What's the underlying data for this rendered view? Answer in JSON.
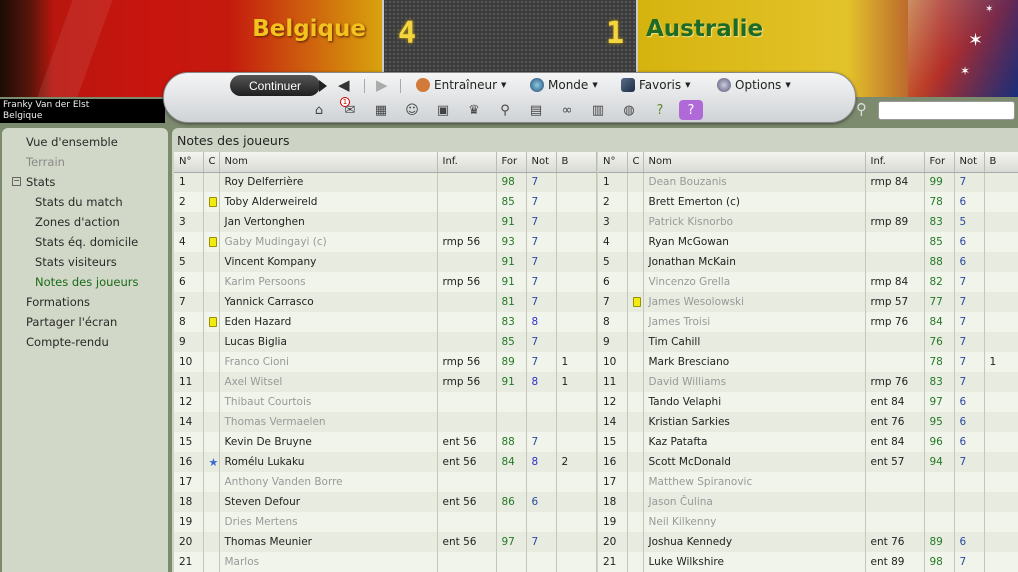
{
  "match": {
    "home_team": "Belgique",
    "away_team": "Australie",
    "home_score": "4",
    "away_score": "1"
  },
  "manager": {
    "name": "Franky Van der Elst",
    "team": "Belgique"
  },
  "toolbar": {
    "continue_label": "Continuer",
    "menus": [
      {
        "label": "Entraîneur",
        "icon": "coach-icon"
      },
      {
        "label": "Monde",
        "icon": "globe-icon"
      },
      {
        "label": "Favoris",
        "icon": "bookmark-icon"
      },
      {
        "label": "Options",
        "icon": "options-icon"
      }
    ],
    "icons": [
      "home-icon",
      "inbox-icon",
      "calendar-icon",
      "squad-icon",
      "tactics-icon",
      "trophy-icon",
      "scout-icon",
      "notes-icon",
      "binoculars-icon",
      "report-icon",
      "globe-world-icon",
      "help-icon",
      "question-icon"
    ],
    "inbox_count": "1"
  },
  "colors": {
    "home_text": "#f3c21e",
    "away_text": "#1d6b26",
    "form_green": "#257825",
    "rating_blue": "#2a48a0",
    "yellow_card": "#f2ea10"
  },
  "sidebar": {
    "items": [
      {
        "label": "Vue d'ensemble",
        "state": "normal",
        "level": 0
      },
      {
        "label": "Terrain",
        "state": "disabled",
        "level": 0
      },
      {
        "label": "Stats",
        "state": "expanded",
        "level": 0,
        "toggle": "−"
      },
      {
        "label": "Stats du match",
        "state": "normal",
        "level": 1
      },
      {
        "label": "Zones d'action",
        "state": "normal",
        "level": 1
      },
      {
        "label": "Stats éq. domicile",
        "state": "normal",
        "level": 1
      },
      {
        "label": "Stats visiteurs",
        "state": "normal",
        "level": 1
      },
      {
        "label": "Notes des joueurs",
        "state": "active",
        "level": 1
      },
      {
        "label": "Formations",
        "state": "normal",
        "level": 0
      },
      {
        "label": "Partager l'écran",
        "state": "normal",
        "level": 0
      },
      {
        "label": "Compte-rendu",
        "state": "normal",
        "level": 0
      }
    ]
  },
  "main": {
    "title": "Notes des joueurs",
    "columns": [
      "N°",
      "C",
      "Nom",
      "Inf.",
      "For",
      "Not",
      "B"
    ],
    "home_players": [
      {
        "no": "1",
        "card": "",
        "name": "Roy Delferrière",
        "sub": false,
        "info": "",
        "form": "98",
        "rating": "7",
        "goals": ""
      },
      {
        "no": "2",
        "card": "yellow",
        "name": "Toby Alderweireld",
        "sub": false,
        "info": "",
        "form": "85",
        "rating": "7",
        "goals": ""
      },
      {
        "no": "3",
        "card": "",
        "name": "Jan Vertonghen",
        "sub": false,
        "info": "",
        "form": "91",
        "rating": "7",
        "goals": ""
      },
      {
        "no": "4",
        "card": "yellow",
        "name": "Gaby Mudingayi (c)",
        "sub": true,
        "info": "rmp 56",
        "form": "93",
        "rating": "7",
        "goals": ""
      },
      {
        "no": "5",
        "card": "",
        "name": "Vincent Kompany",
        "sub": false,
        "info": "",
        "form": "91",
        "rating": "7",
        "goals": ""
      },
      {
        "no": "6",
        "card": "",
        "name": "Karim Persoons",
        "sub": true,
        "info": "rmp 56",
        "form": "91",
        "rating": "7",
        "goals": ""
      },
      {
        "no": "7",
        "card": "",
        "name": "Yannick Carrasco",
        "sub": false,
        "info": "",
        "form": "81",
        "rating": "7",
        "goals": ""
      },
      {
        "no": "8",
        "card": "yellow",
        "name": "Eden Hazard",
        "sub": false,
        "info": "",
        "form": "83",
        "rating": "8",
        "goals": ""
      },
      {
        "no": "9",
        "card": "",
        "name": "Lucas Biglia",
        "sub": false,
        "info": "",
        "form": "85",
        "rating": "7",
        "goals": ""
      },
      {
        "no": "10",
        "card": "",
        "name": "Franco Cioni",
        "sub": true,
        "info": "rmp 56",
        "form": "89",
        "rating": "7",
        "goals": "1"
      },
      {
        "no": "11",
        "card": "",
        "name": "Axel Witsel",
        "sub": true,
        "info": "rmp 56",
        "form": "91",
        "rating": "8",
        "goals": "1"
      },
      {
        "no": "12",
        "card": "",
        "name": "Thibaut Courtois",
        "sub": true,
        "info": "",
        "form": "",
        "rating": "",
        "goals": ""
      },
      {
        "no": "14",
        "card": "",
        "name": "Thomas Vermaelen",
        "sub": true,
        "info": "",
        "form": "",
        "rating": "",
        "goals": ""
      },
      {
        "no": "15",
        "card": "",
        "name": "Kevin De Bruyne",
        "sub": false,
        "info": "ent 56",
        "form": "88",
        "rating": "7",
        "goals": ""
      },
      {
        "no": "16",
        "card": "star",
        "name": "Romélu Lukaku",
        "sub": false,
        "info": "ent 56",
        "form": "84",
        "rating": "8",
        "goals": "2"
      },
      {
        "no": "17",
        "card": "",
        "name": "Anthony Vanden Borre",
        "sub": true,
        "info": "",
        "form": "",
        "rating": "",
        "goals": ""
      },
      {
        "no": "18",
        "card": "",
        "name": "Steven Defour",
        "sub": false,
        "info": "ent 56",
        "form": "86",
        "rating": "6",
        "goals": ""
      },
      {
        "no": "19",
        "card": "",
        "name": "Dries Mertens",
        "sub": true,
        "info": "",
        "form": "",
        "rating": "",
        "goals": ""
      },
      {
        "no": "20",
        "card": "",
        "name": "Thomas Meunier",
        "sub": false,
        "info": "ent 56",
        "form": "97",
        "rating": "7",
        "goals": ""
      },
      {
        "no": "21",
        "card": "",
        "name": "Marlos",
        "sub": true,
        "info": "",
        "form": "",
        "rating": "",
        "goals": ""
      }
    ],
    "away_players": [
      {
        "no": "1",
        "card": "",
        "name": "Dean Bouzanis",
        "sub": true,
        "info": "rmp 84",
        "form": "99",
        "rating": "7",
        "goals": ""
      },
      {
        "no": "2",
        "card": "",
        "name": "Brett Emerton (c)",
        "sub": false,
        "info": "",
        "form": "78",
        "rating": "6",
        "goals": ""
      },
      {
        "no": "3",
        "card": "",
        "name": "Patrick Kisnorbo",
        "sub": true,
        "info": "rmp 89",
        "form": "83",
        "rating": "5",
        "goals": ""
      },
      {
        "no": "4",
        "card": "",
        "name": "Ryan McGowan",
        "sub": false,
        "info": "",
        "form": "85",
        "rating": "6",
        "goals": ""
      },
      {
        "no": "5",
        "card": "",
        "name": "Jonathan McKain",
        "sub": false,
        "info": "",
        "form": "88",
        "rating": "6",
        "goals": ""
      },
      {
        "no": "6",
        "card": "",
        "name": "Vincenzo Grella",
        "sub": true,
        "info": "rmp 84",
        "form": "82",
        "rating": "7",
        "goals": ""
      },
      {
        "no": "7",
        "card": "yellow",
        "name": "James Wesolowski",
        "sub": true,
        "info": "rmp 57",
        "form": "77",
        "rating": "7",
        "goals": ""
      },
      {
        "no": "8",
        "card": "",
        "name": "James Troisi",
        "sub": true,
        "info": "rmp 76",
        "form": "84",
        "rating": "7",
        "goals": ""
      },
      {
        "no": "9",
        "card": "",
        "name": "Tim Cahill",
        "sub": false,
        "info": "",
        "form": "76",
        "rating": "7",
        "goals": ""
      },
      {
        "no": "10",
        "card": "",
        "name": "Mark Bresciano",
        "sub": false,
        "info": "",
        "form": "78",
        "rating": "7",
        "goals": "1"
      },
      {
        "no": "11",
        "card": "",
        "name": "David Williams",
        "sub": true,
        "info": "rmp 76",
        "form": "83",
        "rating": "7",
        "goals": ""
      },
      {
        "no": "12",
        "card": "",
        "name": "Tando Velaphi",
        "sub": false,
        "info": "ent 84",
        "form": "97",
        "rating": "6",
        "goals": ""
      },
      {
        "no": "14",
        "card": "",
        "name": "Kristian Sarkies",
        "sub": false,
        "info": "ent 76",
        "form": "95",
        "rating": "6",
        "goals": ""
      },
      {
        "no": "15",
        "card": "",
        "name": "Kaz Patafta",
        "sub": false,
        "info": "ent 84",
        "form": "96",
        "rating": "6",
        "goals": ""
      },
      {
        "no": "16",
        "card": "",
        "name": "Scott McDonald",
        "sub": false,
        "info": "ent 57",
        "form": "94",
        "rating": "7",
        "goals": ""
      },
      {
        "no": "17",
        "card": "",
        "name": "Matthew Spiranovic",
        "sub": true,
        "info": "",
        "form": "",
        "rating": "",
        "goals": ""
      },
      {
        "no": "18",
        "card": "",
        "name": "Jason Čulina",
        "sub": true,
        "info": "",
        "form": "",
        "rating": "",
        "goals": ""
      },
      {
        "no": "19",
        "card": "",
        "name": "Neil Kilkenny",
        "sub": true,
        "info": "",
        "form": "",
        "rating": "",
        "goals": ""
      },
      {
        "no": "20",
        "card": "",
        "name": "Joshua Kennedy",
        "sub": false,
        "info": "ent 76",
        "form": "89",
        "rating": "6",
        "goals": ""
      },
      {
        "no": "21",
        "card": "",
        "name": "Luke Wilkshire",
        "sub": false,
        "info": "ent 89",
        "form": "98",
        "rating": "7",
        "goals": ""
      }
    ]
  }
}
